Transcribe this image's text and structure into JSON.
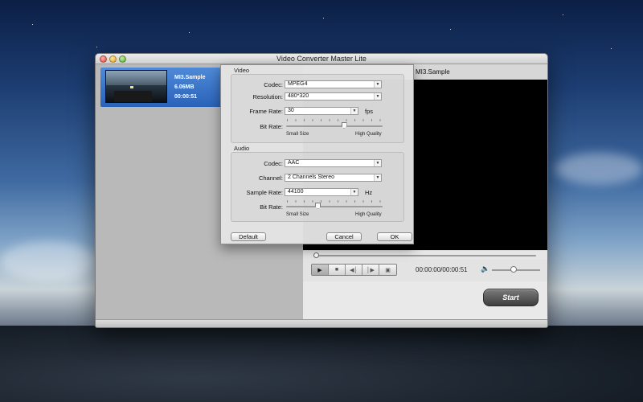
{
  "window": {
    "title": "Video Converter Master Lite"
  },
  "file": {
    "name": "MI3.Sample",
    "size": "6.06MB",
    "duration": "00:00:51"
  },
  "preview": {
    "title": "MI3.Sample",
    "time": "00:00:00/00:00:51",
    "seek_progress": 0,
    "volume_level": 0.45
  },
  "player_controls": {
    "icons": [
      "play-icon",
      "stop-icon",
      "previous-icon",
      "next-icon",
      "snapshot-icon"
    ]
  },
  "start_button": {
    "label": "Start"
  },
  "settings": {
    "video": {
      "group_label": "Video",
      "codec_label": "Codec:",
      "codec_value": "MPEG4",
      "resolution_label": "Resolution:",
      "resolution_value": "480*320",
      "frame_rate_label": "Frame Rate:",
      "frame_rate_value": "30",
      "frame_rate_unit": "fps",
      "bitrate_label": "Bit Rate:",
      "bitrate_level": 0.6,
      "bitrate_min_label": "Small Size",
      "bitrate_max_label": "High Quality"
    },
    "audio": {
      "group_label": "Audio",
      "codec_label": "Codec:",
      "codec_value": "AAC",
      "channel_label": "Channel:",
      "channel_value": "2 Channels Stereo",
      "sample_rate_label": "Sample Rate:",
      "sample_rate_value": "44100",
      "sample_rate_unit": "Hz",
      "bitrate_label": "Bit Rate:",
      "bitrate_level": 0.33,
      "bitrate_min_label": "Small Size",
      "bitrate_max_label": "High Quality"
    },
    "buttons": {
      "default_label": "Default",
      "cancel_label": "Cancel",
      "ok_label": "OK"
    }
  }
}
